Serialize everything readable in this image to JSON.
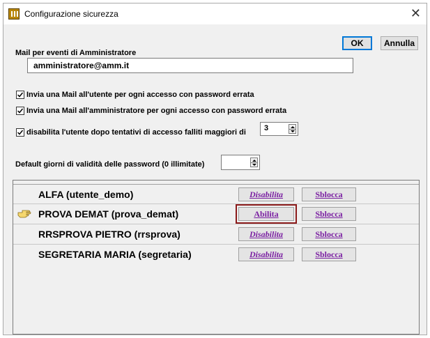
{
  "window": {
    "title": "Configurazione sicurezza",
    "close_glyph": "✕"
  },
  "buttons": {
    "ok_label": "OK",
    "cancel_label": "Annulla"
  },
  "admin_mail": {
    "label": "Mail per eventi di Amministratore",
    "value": "amministratore@amm.it"
  },
  "options": [
    {
      "label": "Invia una Mail all'utente per ogni accesso con password errata",
      "checked": true
    },
    {
      "label": "Invia una Mail all'amministratore per ogni accesso con password errata",
      "checked": true
    },
    {
      "label": "disabilita l'utente dopo tentativi di accesso falliti maggiori di",
      "checked": true
    }
  ],
  "max_attempts": {
    "value": "3"
  },
  "password_validity": {
    "label": "Default giorni di validità delle password (0 illimitate)",
    "value": ""
  },
  "users": [
    {
      "name": "ALFA (utente_demo)",
      "toggle_label": "Disabilita",
      "unlock_label": "Sblocca",
      "current": false
    },
    {
      "name": "PROVA DEMAT (prova_demat)",
      "toggle_label": "Abilita",
      "unlock_label": "Sblocca",
      "current": true
    },
    {
      "name": "RRSPROVA PIETRO (rrsprova)",
      "toggle_label": "Disabilita",
      "unlock_label": "Sblocca",
      "current": false
    },
    {
      "name": "SEGRETARIA MARIA (segretaria)",
      "toggle_label": "Disabilita",
      "unlock_label": "Sblocca",
      "current": false
    }
  ],
  "colors": {
    "link": "#7a1fa2",
    "focus": "#8b1a1a",
    "dialog_bg": "#f0f0f0"
  },
  "icons": {
    "current_row": "pointing-hand-icon",
    "app": "app-icon"
  }
}
